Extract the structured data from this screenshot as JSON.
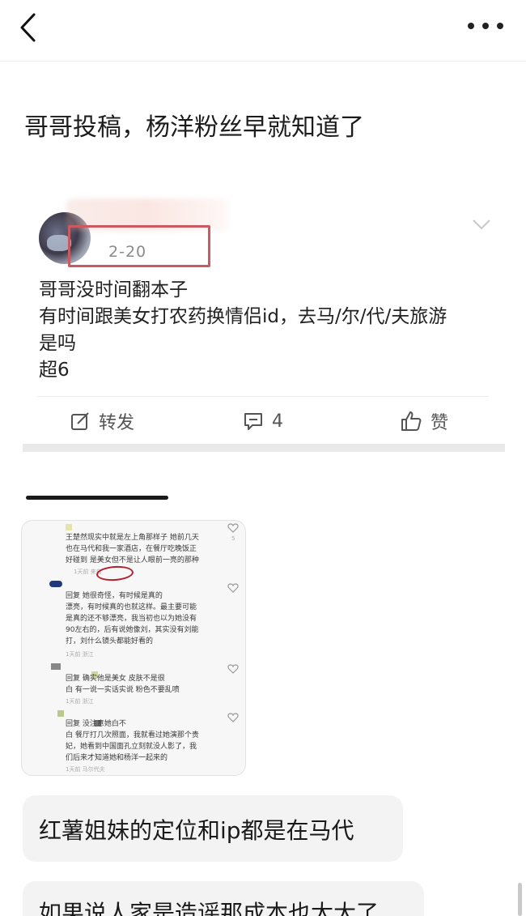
{
  "topbar": {
    "back_icon": "chevron-left-icon",
    "more_icon": "more-horizontal-icon"
  },
  "post": {
    "title": "哥哥投稿，杨洋粉丝早就知道了"
  },
  "card": {
    "date": "2-20",
    "highlight_color": "#c95a62",
    "lines": [
      "哥哥没时间翻本子",
      "有时间跟美女打农药换情侣id，去马/尔/代/夫旅游",
      "是吗",
      "超6"
    ],
    "actions": {
      "repost_label": "转发",
      "comment_count": "4",
      "like_label": "赞"
    }
  },
  "screenshot": {
    "comments": [
      {
        "lines": [
          "王楚然现实中就是左上角那样子 她前几天",
          "也在马代和我一家酒店，在餐厅吃晚饭正",
          "好碰到 是美女但不是让人眼前一亮的那种"
        ],
        "meta": "1天前 来自"
      },
      {
        "lines": [
          "回复          她很奇怪，有时候是真的",
          "漂亮，有时候真的也就这样。最主要可能",
          "是真的还不够漂亮，我当初也以为她没有",
          "90左右的，后有说她像刘，其实没有刘能",
          "打，刘什么镜头都能好看的"
        ],
        "meta": "1天前 浙江"
      },
      {
        "lines": [
          "回复          确实他是美女 皮肤不是很",
          "白 有一说一实话实说 粉色不要乱喷"
        ],
        "meta": "1天前 浙江"
      },
      {
        "lines": [
          "回复                没注意她白不",
          "白 餐厅打几次照面，我就看过她演那个贵",
          "妃，她看到中国面孔立刻就没人影了，我",
          "们后来才知道她和杨洋一起来的"
        ],
        "meta": "1天前 马尔代夫"
      }
    ],
    "like_counts": [
      "5"
    ]
  },
  "bubbles": [
    "红薯姐妹的定位和ip都是在马代",
    "如果说人家是造谣那成本也太大了"
  ]
}
